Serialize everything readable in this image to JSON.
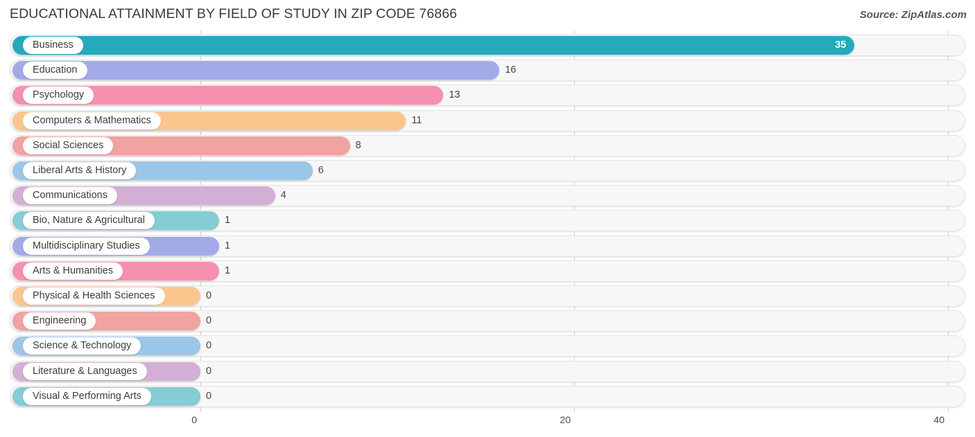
{
  "header": {
    "title": "EDUCATIONAL ATTAINMENT BY FIELD OF STUDY IN ZIP CODE 76866",
    "source": "Source: ZipAtlas.com"
  },
  "chart_data": {
    "type": "bar",
    "orientation": "horizontal",
    "title": "EDUCATIONAL ATTAINMENT BY FIELD OF STUDY IN ZIP CODE 76866",
    "xlabel": "",
    "ylabel": "",
    "xlim": [
      0,
      40
    ],
    "xticks": [
      0,
      20,
      40
    ],
    "xtick_labels": [
      "0",
      "20",
      "40"
    ],
    "grid": true,
    "legend": "none",
    "categories": [
      "Business",
      "Education",
      "Psychology",
      "Computers & Mathematics",
      "Social Sciences",
      "Liberal Arts & History",
      "Communications",
      "Bio, Nature & Agricultural",
      "Multidisciplinary Studies",
      "Arts & Humanities",
      "Physical & Health Sciences",
      "Engineering",
      "Science & Technology",
      "Literature & Languages",
      "Visual & Performing Arts"
    ],
    "values": [
      35,
      16,
      13,
      11,
      8,
      6,
      4,
      1,
      1,
      1,
      0,
      0,
      0,
      0,
      0
    ],
    "value_labels": [
      "35",
      "16",
      "13",
      "11",
      "8",
      "6",
      "4",
      "1",
      "1",
      "1",
      "0",
      "0",
      "0",
      "0",
      "0"
    ],
    "colors": [
      "#25aabc",
      "#a2aae8",
      "#f590af",
      "#fbc68e",
      "#f0a3a0",
      "#9cc6e8",
      "#d3afd5",
      "#85cdd2",
      "#a2aae8",
      "#f590af",
      "#fbc68e",
      "#f0a3a0",
      "#9cc6e8",
      "#d3afd5",
      "#85cdd2"
    ]
  }
}
